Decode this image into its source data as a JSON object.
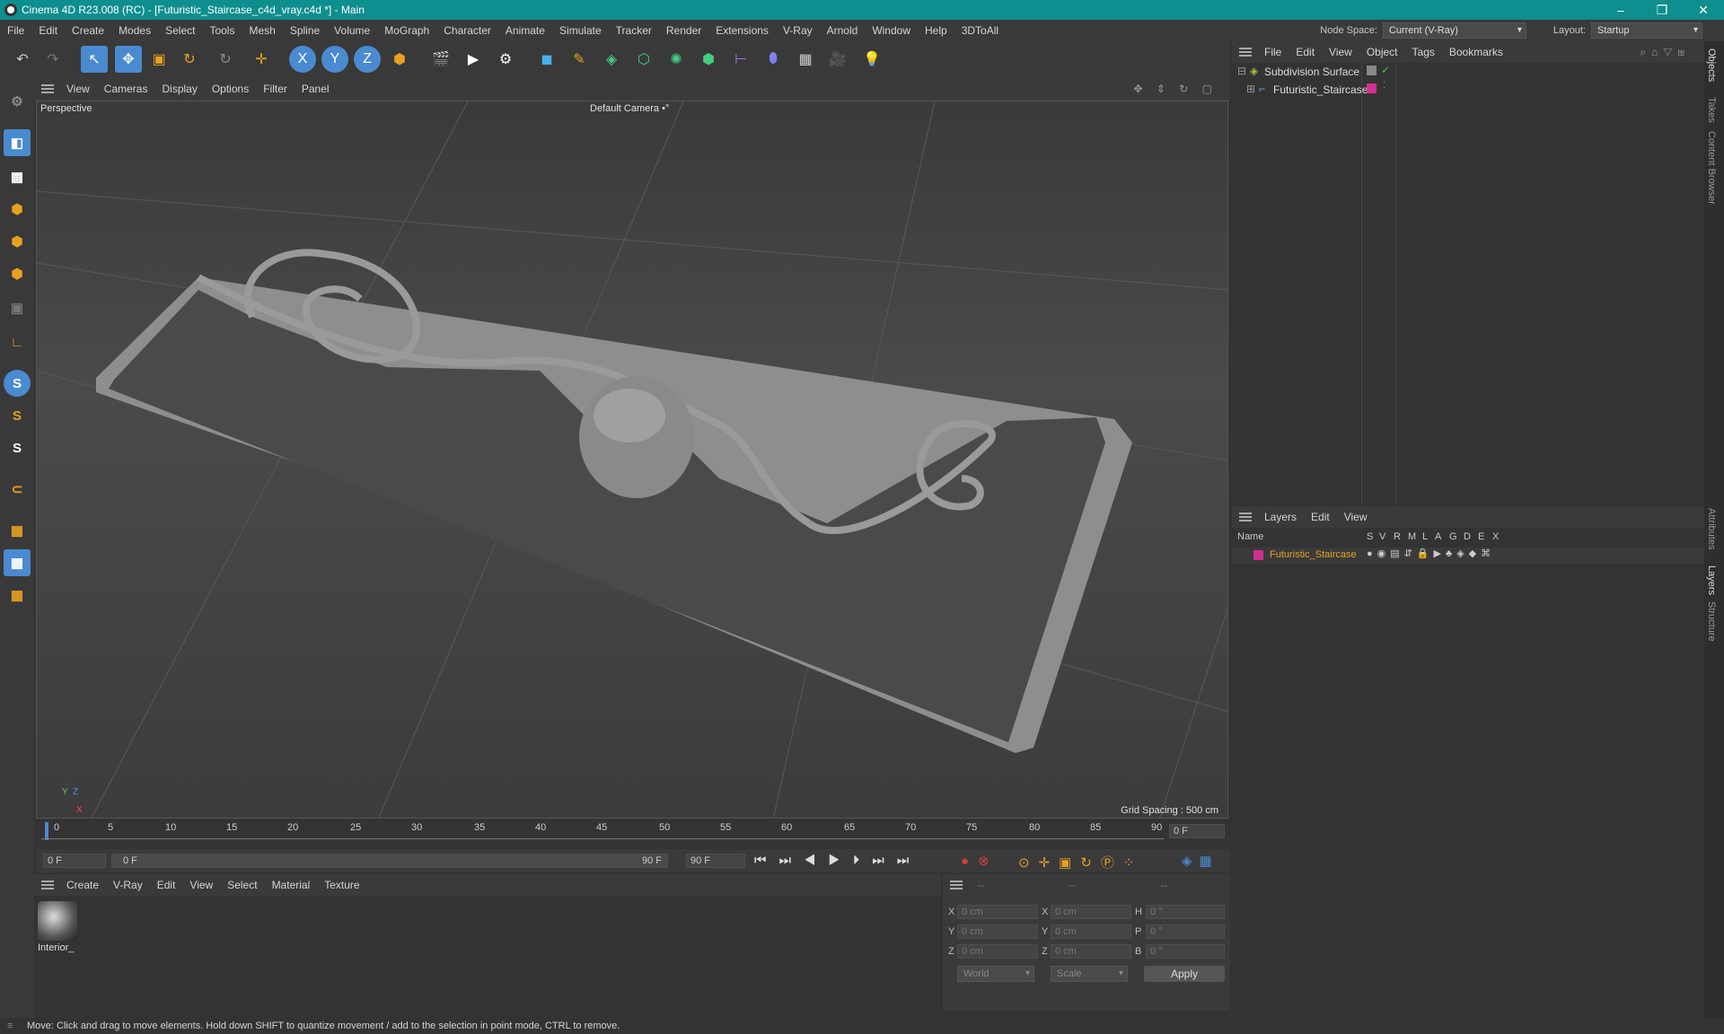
{
  "window": {
    "title": "Cinema 4D R23.008 (RC) - [Futuristic_Staircase_c4d_vray.c4d *] - Main",
    "controls": [
      "–",
      "❐",
      "✕"
    ]
  },
  "menu": [
    "File",
    "Edit",
    "Create",
    "Modes",
    "Select",
    "Tools",
    "Mesh",
    "Spline",
    "Volume",
    "MoGraph",
    "Character",
    "Animate",
    "Simulate",
    "Tracker",
    "Render",
    "Extensions",
    "V-Ray",
    "Arnold",
    "Window",
    "Help",
    "3DToAll"
  ],
  "node_space": {
    "label": "Node Space:",
    "value": "Current (V-Ray)"
  },
  "layout": {
    "label": "Layout:",
    "value": "Startup"
  },
  "viewport": {
    "menu": [
      "View",
      "Cameras",
      "Display",
      "Options",
      "Filter",
      "Panel"
    ],
    "label": "Perspective",
    "camera": "Default Camera",
    "camera_icon": "•°",
    "grid_spacing": "Grid Spacing : 500 cm",
    "axis": {
      "y": "Y",
      "z": "Z",
      "x": "X"
    }
  },
  "timeline": {
    "ticks": [
      "0",
      "5",
      "10",
      "15",
      "20",
      "25",
      "30",
      "35",
      "40",
      "45",
      "50",
      "55",
      "60",
      "65",
      "70",
      "75",
      "80",
      "85",
      "90"
    ],
    "current": "0 F",
    "start": "0 F",
    "range_start": "0 F",
    "range_end": "90 F",
    "end": "90 F"
  },
  "materials": {
    "menu": [
      "Create",
      "V-Ray",
      "Edit",
      "View",
      "Select",
      "Material",
      "Texture"
    ],
    "items": [
      {
        "name": "Interior_"
      }
    ]
  },
  "coords": {
    "headers": [
      "--",
      "--",
      "--"
    ],
    "rows": [
      {
        "a": "X",
        "av": "0 cm",
        "b": "X",
        "bv": "0 cm",
        "c": "H",
        "cv": "0 °"
      },
      {
        "a": "Y",
        "av": "0 cm",
        "b": "Y",
        "bv": "0 cm",
        "c": "P",
        "cv": "0 °"
      },
      {
        "a": "Z",
        "av": "0 cm",
        "b": "Z",
        "bv": "0 cm",
        "c": "B",
        "cv": "0 °"
      }
    ],
    "world": "World",
    "scale": "Scale",
    "apply": "Apply"
  },
  "objects": {
    "menu": [
      "File",
      "Edit",
      "View",
      "Object",
      "Tags",
      "Bookmarks"
    ],
    "items": [
      {
        "name": "Subdivision Surface",
        "color": "#a0c040"
      },
      {
        "name": "Futuristic_Staircase",
        "color": "#d03090"
      }
    ]
  },
  "layers": {
    "menu": [
      "Layers",
      "Edit",
      "View"
    ],
    "columns": [
      "Name",
      "S",
      "V",
      "R",
      "M",
      "L",
      "A",
      "G",
      "D",
      "E",
      "X"
    ],
    "items": [
      {
        "name": "Futuristic_Staircase",
        "color": "#d03090"
      }
    ]
  },
  "side_tabs": [
    "Objects",
    "Takes",
    "Content Browser",
    "Attributes",
    "Layers",
    "Structure"
  ],
  "status": "Move: Click and drag to move elements. Hold down SHIFT to quantize movement / add to the selection in point mode, CTRL to remove.",
  "colors": {
    "titlebar": "#0e8e8e",
    "accent_orange": "#e8a020",
    "accent_blue": "#4a8ad0"
  }
}
